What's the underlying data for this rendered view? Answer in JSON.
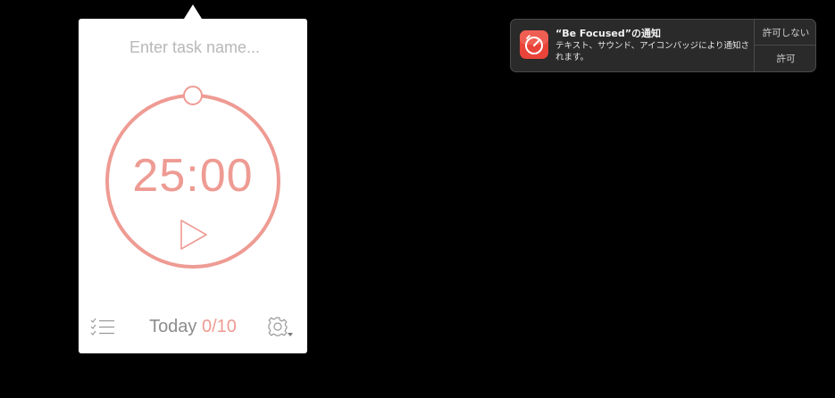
{
  "popover": {
    "task_placeholder": "Enter task name...",
    "timer": "25:00",
    "today_label": "Today",
    "today_count": "0/10",
    "accent_color": "#ee9b93",
    "icons": {
      "play": "play-icon",
      "list": "task-list-icon",
      "settings": "gear-icon"
    }
  },
  "notification": {
    "title": "“Be Focused”の通知",
    "body": "テキスト、サウンド、アイコンバッジにより通知されます。",
    "deny_label": "許可しない",
    "allow_label": "許可",
    "app_icon": "be-focused-app-icon"
  }
}
